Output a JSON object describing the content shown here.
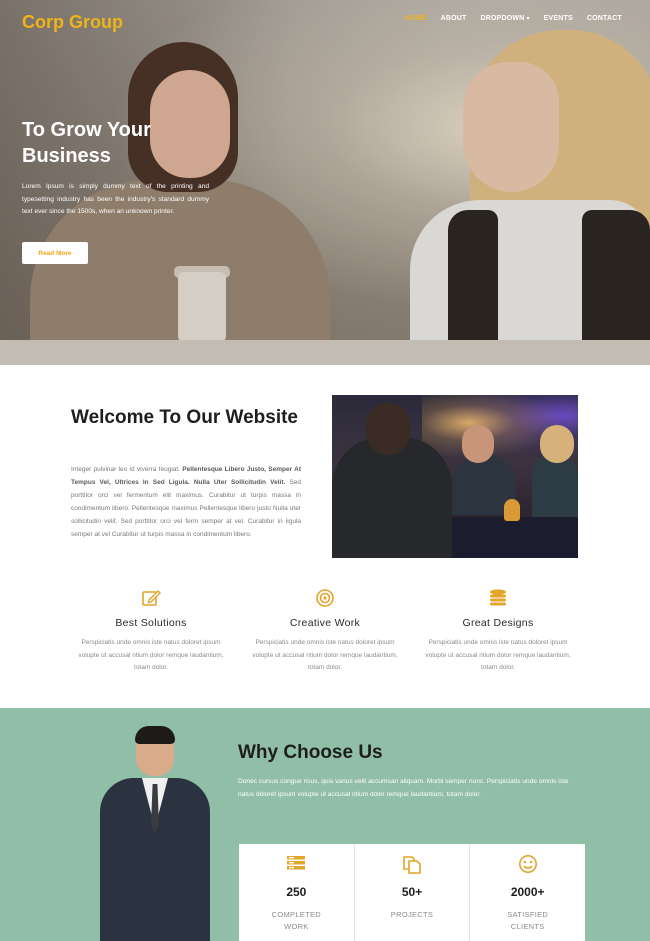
{
  "nav": {
    "logo": "Corp Group",
    "items": [
      {
        "label": "HOME",
        "active": true
      },
      {
        "label": "ABOUT",
        "active": false
      },
      {
        "label": "DROPDOWN",
        "active": false,
        "has_caret": true
      },
      {
        "label": "EVENTS",
        "active": false
      },
      {
        "label": "CONTACT",
        "active": false
      }
    ]
  },
  "hero": {
    "title": "To Grow Your Business",
    "text": "Lorem Ipsum is simply dummy text of the printing and typesetting industry has been the industry's standard dummy text ever since the 1500s, when an unknown printer.",
    "button": "Read More"
  },
  "welcome": {
    "title": "Welcome To Our Website",
    "text_intro": "Integer pulvinar leo id viverra feugiat.",
    "text_bold": "Pellentesque Libero Justo, Semper At Tempus Vel, Ultrices In Sed Ligula. Nulla Uter Sollicitudin Velit.",
    "text_rest": "Sed porttitor orci vel fermentum elit maximus. Curabitur ut turpis massa in condimentum libero. Pellentesque maximus Pellentesque libero justo Nulla uter sollicitudin velit. Sed porttitor orci vel ferm semper at vel. Curabitur in ligula semper at vel Curabitur ut turpis massa in condimentum libero."
  },
  "features": [
    {
      "icon": "edit-icon",
      "title": "Best Solutions",
      "text": "Perspiciatis unde omnis iste natus doloret ipsum volupte ut accusal ntium dolor remque laudantium, totam dolor."
    },
    {
      "icon": "target-icon",
      "title": "Creative Work",
      "text": "Perspiciatis unde omnis iste natus doloret ipsum volupte ut accusal ntium dolor remque laudantium, totam dolor."
    },
    {
      "icon": "coins-icon",
      "title": "Great Designs",
      "text": "Perspiciatis unde omnis iste natus doloret ipsum volupte ut accusal ntium dolor remque laudantium, totam dolor."
    }
  ],
  "why": {
    "title": "Why Choose Us",
    "text": "Donec cursus congue risus, quis varius velit accumsan aliquam. Morbi semper nunc. Perspiciatis unde omnis iste natus doloret ipsum volupte ut accusal ntium dolor remque laudantium, totam dolor.",
    "stats": [
      {
        "icon": "stack-icon",
        "number": "250",
        "label": "Completed Work"
      },
      {
        "icon": "copy-icon",
        "number": "50+",
        "label": "Projects"
      },
      {
        "icon": "smile-icon",
        "number": "2000+",
        "label": "Satisfied Clients"
      }
    ]
  },
  "colors": {
    "accent": "#f0b41a",
    "why_bg": "#91bea6"
  }
}
